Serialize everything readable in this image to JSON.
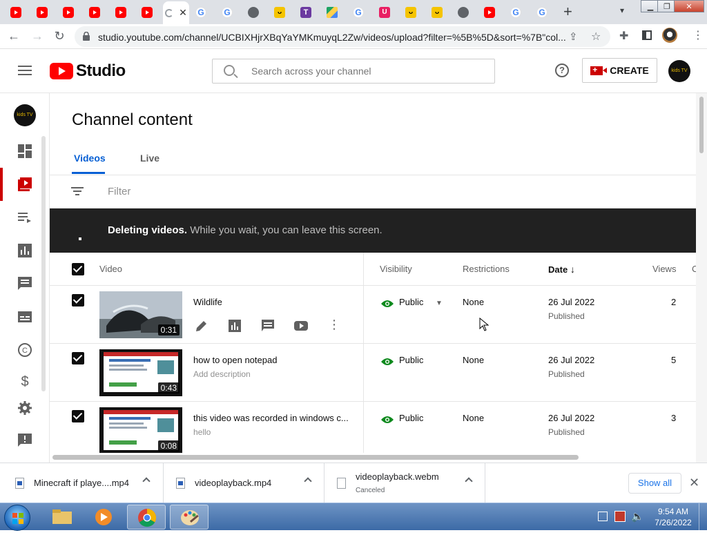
{
  "browser": {
    "url": "studio.youtube.com/channel/UCBIXHjrXBqYaYMKmuyqL2Zw/videos/upload?filter=%5B%5D&sort=%7B\"col...",
    "tab_icons": [
      "youtube-icon",
      "youtube-icon",
      "youtube-icon",
      "youtube-icon",
      "youtube-icon",
      "youtube-icon",
      "active",
      "google-icon",
      "google-icon",
      "globe-icon",
      "smile-icon",
      "tr-icon",
      "drive-icon",
      "google-icon",
      "pink-icon",
      "smile-icon",
      "smile-icon",
      "globe-icon",
      "youtube-icon",
      "google-icon",
      "google-icon"
    ],
    "new_tab_label": "+"
  },
  "header": {
    "logo_text": "Studio",
    "search_placeholder": "Search across your channel",
    "help_label": "?",
    "create_label": "CREATE",
    "avatar_text": "kids TV"
  },
  "rail": {
    "avatar_text": "kids TV",
    "items": [
      "dashboard-icon",
      "content-icon",
      "playlists-icon",
      "analytics-icon",
      "comments-icon",
      "subtitles-icon",
      "copyright-icon",
      "earn-icon",
      "settings-icon",
      "feedback-icon"
    ]
  },
  "main": {
    "title": "Channel content",
    "tabs": [
      {
        "label": "Videos"
      },
      {
        "label": "Live"
      }
    ],
    "filter_label": "Filter",
    "banner_bold": "Deleting videos.",
    "banner_text": " While you wait, you can leave this screen.",
    "columns": {
      "video": "Video",
      "visibility": "Visibility",
      "restrictions": "Restrictions",
      "date": "Date",
      "views": "Views",
      "comments": "C"
    }
  },
  "videos": [
    {
      "title": "Wildlife",
      "description": "",
      "duration": "0:31",
      "visibility": "Public",
      "restrictions": "None",
      "date": "26 Jul 2022",
      "status": "Published",
      "views": "2"
    },
    {
      "title": "how to open notepad",
      "description": "Add description",
      "duration": "0:43",
      "visibility": "Public",
      "restrictions": "None",
      "date": "26 Jul 2022",
      "status": "Published",
      "views": "5"
    },
    {
      "title": "this video was recorded in windows c...",
      "description": "hello",
      "duration": "0:08",
      "visibility": "Public",
      "restrictions": "None",
      "date": "26 Jul 2022",
      "status": "Published",
      "views": "3"
    }
  ],
  "downloads": {
    "items": [
      {
        "name": "Minecraft if playe....mp4",
        "sub": ""
      },
      {
        "name": "videoplayback.mp4",
        "sub": ""
      },
      {
        "name": "videoplayback.webm",
        "sub": "Canceled"
      }
    ],
    "show_all": "Show all"
  },
  "taskbar": {
    "time": "9:54 AM",
    "date": "7/26/2022"
  }
}
